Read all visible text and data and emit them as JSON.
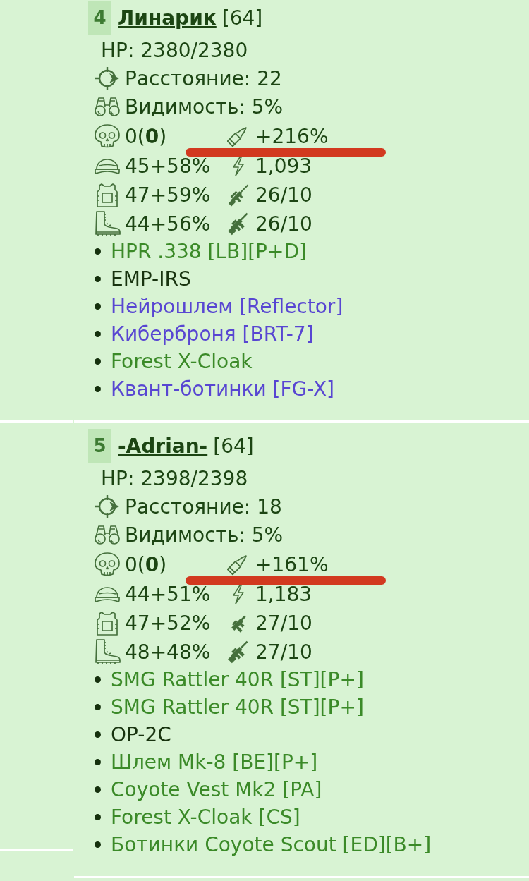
{
  "cards": [
    {
      "rank": "4",
      "name": "Линарик",
      "tag": "[64]",
      "hp": "HP: 2380/2380",
      "info": [
        {
          "kind": "distance",
          "text": "Расстояние: 22"
        },
        {
          "kind": "visibility",
          "text": "Видимость: 5%"
        }
      ],
      "stat_rows": [
        {
          "marked": true,
          "left": {
            "kind": "kills",
            "text": "0(**0**)"
          },
          "right": {
            "kind": "bullet",
            "text": "+216%"
          }
        },
        {
          "marked": false,
          "left": {
            "kind": "helmet",
            "text": "45+58%"
          },
          "right": {
            "kind": "energy",
            "text": "1,093"
          }
        },
        {
          "marked": false,
          "left": {
            "kind": "vest",
            "text": "47+59%"
          },
          "right": {
            "kind": "sniper",
            "text": "26/10"
          }
        },
        {
          "marked": false,
          "left": {
            "kind": "boots",
            "text": "44+56%"
          },
          "right": {
            "kind": "assault",
            "text": "26/10"
          }
        }
      ],
      "items": [
        {
          "text": "HPR .338 [LB][P+D]",
          "color": "#3b8a28"
        },
        {
          "text": "EMP-IRS",
          "color": "#18330f"
        },
        {
          "text": "Нейрошлем [Reflector]",
          "color": "#5846d2"
        },
        {
          "text": "Киберброня [BRT-7]",
          "color": "#5846d2"
        },
        {
          "text": "Forest X-Cloak",
          "color": "#3b8a28"
        },
        {
          "text": "Квант-ботинки [FG-X]",
          "color": "#5846d2"
        }
      ]
    },
    {
      "rank": "5",
      "name": "-Adrian-",
      "tag": "[64]",
      "hp": "HP: 2398/2398",
      "info": [
        {
          "kind": "distance",
          "text": "Расстояние: 18"
        },
        {
          "kind": "visibility",
          "text": "Видимость: 5%"
        }
      ],
      "stat_rows": [
        {
          "marked": true,
          "left": {
            "kind": "kills",
            "text": "0(**0**)"
          },
          "right": {
            "kind": "bullet",
            "text": "+161%"
          }
        },
        {
          "marked": false,
          "left": {
            "kind": "helmet",
            "text": "44+51%"
          },
          "right": {
            "kind": "energy",
            "text": "1,183"
          }
        },
        {
          "marked": false,
          "left": {
            "kind": "vest",
            "text": "47+52%"
          },
          "right": {
            "kind": "smg",
            "text": "27/10"
          }
        },
        {
          "marked": false,
          "left": {
            "kind": "boots",
            "text": "48+48%"
          },
          "right": {
            "kind": "assault",
            "text": "27/10"
          }
        }
      ],
      "items": [
        {
          "text": "SMG Rattler 40R [ST][P+]",
          "color": "#3b8a28"
        },
        {
          "text": "SMG Rattler 40R [ST][P+]",
          "color": "#3b8a28"
        },
        {
          "text": "OP-2C",
          "color": "#18330f"
        },
        {
          "text": "Шлем Mk-8 [BE][P+]",
          "color": "#3b8a28"
        },
        {
          "text": "Coyote Vest Mk2 [PA]",
          "color": "#3b8a28"
        },
        {
          "text": "Forest X-Cloak [CS]",
          "color": "#3b8a28"
        },
        {
          "text": "Ботинки Coyote Scout [ED][B+]",
          "color": "#3b8a28"
        }
      ]
    }
  ]
}
